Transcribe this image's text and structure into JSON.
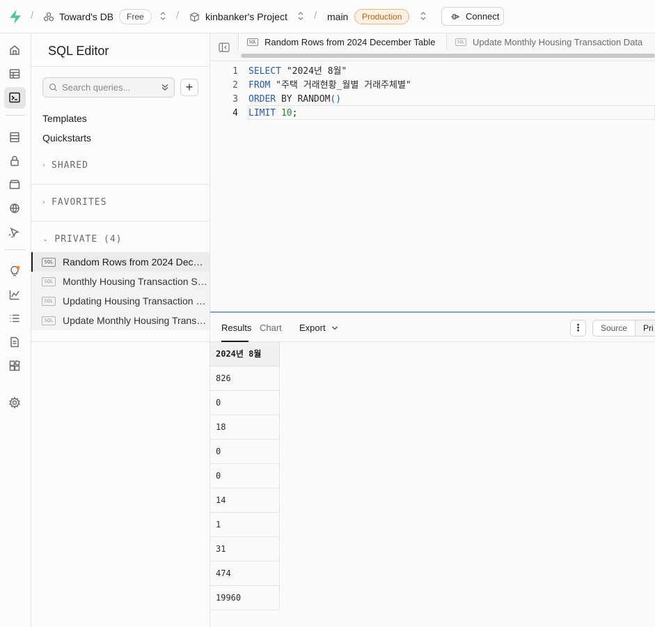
{
  "topbar": {
    "org_name": "Toward's DB",
    "plan_badge": "Free",
    "project_name": "kinbanker's Project",
    "branch": "main",
    "env_badge": "Production",
    "connect_label": "Connect",
    "separator": "/",
    "brand_color": "#3ecf8e"
  },
  "sidebar": {
    "title": "SQL Editor",
    "search_placeholder": "Search queries...",
    "links": [
      "Templates",
      "Quickstarts"
    ],
    "sections": {
      "shared": "SHARED",
      "favorites": "FAVORITES",
      "private": "PRIVATE (4)"
    },
    "sql_tag": "SQL",
    "queries": [
      {
        "label": "Random Rows from 2024 December Table",
        "active": true
      },
      {
        "label": "Monthly Housing Transaction Summary",
        "active": false
      },
      {
        "label": "Updating Housing Transaction Data",
        "active": false
      },
      {
        "label": "Update Monthly Housing Transaction Data",
        "active": false
      }
    ]
  },
  "tabs": [
    {
      "label": "Random Rows from 2024 December Table",
      "active": true
    },
    {
      "label": "Update Monthly Housing Transaction Data",
      "active": false
    }
  ],
  "editor": {
    "line_numbers": [
      "1",
      "2",
      "3",
      "4"
    ],
    "lines": [
      {
        "kw": "SELECT",
        "rest": " \"2024년 8월\""
      },
      {
        "kw": "FROM",
        "rest": " \"주택 거래현황_월별 거래주체별\""
      },
      {
        "kw": "ORDER",
        "rest": " BY RANDOM",
        "paren": "()"
      },
      {
        "kw": "LIMIT",
        "num": "10",
        "tail": ";"
      }
    ]
  },
  "results": {
    "tabs": [
      "Results",
      "Chart"
    ],
    "export_label": "Export",
    "view_toggle": [
      "Source",
      "Pri"
    ],
    "column_header": "2024년 8월",
    "rows": [
      "826",
      "0",
      "18",
      "0",
      "0",
      "14",
      "1",
      "31",
      "474",
      "19960"
    ]
  }
}
